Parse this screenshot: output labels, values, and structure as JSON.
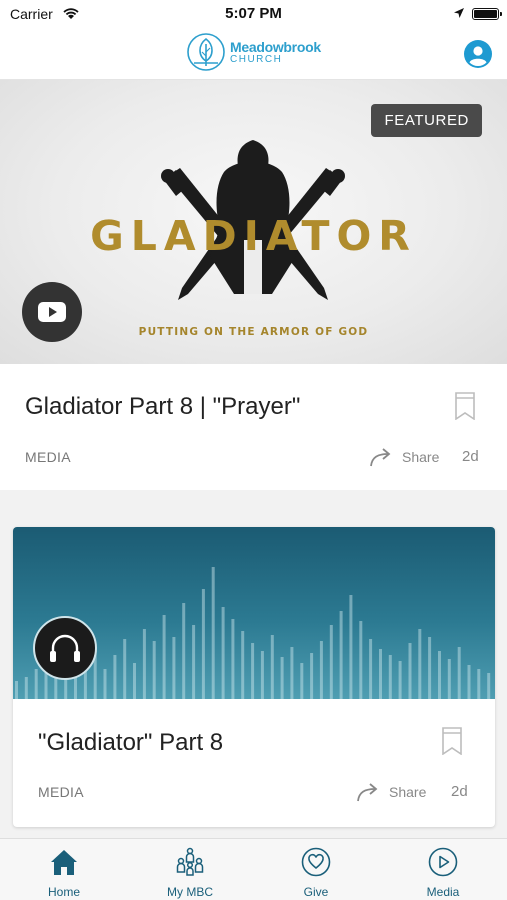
{
  "status_bar": {
    "carrier": "Carrier",
    "time": "5:07 PM"
  },
  "header": {
    "logo_line1": "Meadowbrook",
    "logo_line2": "CHURCH"
  },
  "featured_card": {
    "badge": "FEATURED",
    "hero_word": "GLADIATOR",
    "hero_tagline": "PUTTING ON THE ARMOR OF GOD",
    "title": "Gladiator Part 8 | \"Prayer\"",
    "category": "MEDIA",
    "share_label": "Share",
    "age": "2d"
  },
  "audio_card": {
    "title": "\"Gladiator\" Part 8",
    "category": "MEDIA",
    "share_label": "Share",
    "age": "2d"
  },
  "tabbar": {
    "tabs": [
      {
        "label": "Home",
        "icon": "home-icon",
        "active": true
      },
      {
        "label": "My MBC",
        "icon": "people-icon",
        "active": false
      },
      {
        "label": "Give",
        "icon": "heart-icon",
        "active": false
      },
      {
        "label": "Media",
        "icon": "play-icon",
        "active": false
      }
    ]
  },
  "colors": {
    "brand_blue": "#2d9fcd",
    "tab_teal": "#1a5f7a",
    "hero_gold": "#b08c2d"
  }
}
